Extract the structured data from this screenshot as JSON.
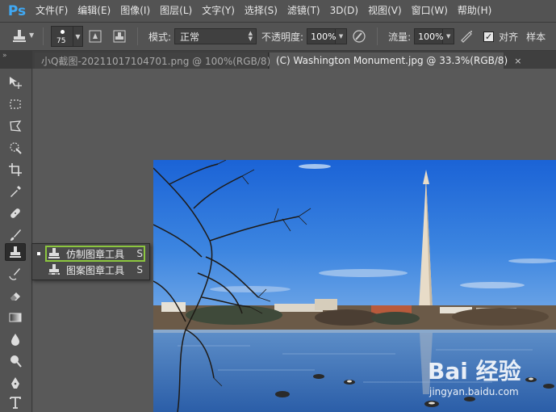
{
  "app": {
    "logo": "Ps",
    "menu": [
      "文件(F)",
      "编辑(E)",
      "图像(I)",
      "图层(L)",
      "文字(Y)",
      "选择(S)",
      "滤镜(T)",
      "3D(D)",
      "视图(V)",
      "窗口(W)",
      "帮助(H)"
    ]
  },
  "options": {
    "brush_size": "75",
    "mode_label": "模式:",
    "mode_value": "正常",
    "opacity_label": "不透明度:",
    "opacity_value": "100%",
    "flow_label": "流量:",
    "flow_value": "100%",
    "align_checked": true,
    "align_label": "对齐",
    "sample_label": "样本"
  },
  "tabs": [
    {
      "label": "小Q截图-20211017104701.png @ 100%(RGB/8)",
      "close": "×",
      "active": false
    },
    {
      "label": "(C) Washington Monument.jpg @ 33.3%(RGB/8)",
      "close": "×",
      "active": true
    }
  ],
  "flyout": {
    "items": [
      {
        "label": "仿制图章工具",
        "shortcut": "S",
        "selected": true
      },
      {
        "label": "图案图章工具",
        "shortcut": "S",
        "selected": false
      }
    ]
  },
  "watermark": {
    "logo": "Bai 经验",
    "url": "jingyan.baidu.com"
  },
  "colors": {
    "accent_ps": "#3fa9f5",
    "highlight": "#8cc63f",
    "bg": "#535353"
  }
}
